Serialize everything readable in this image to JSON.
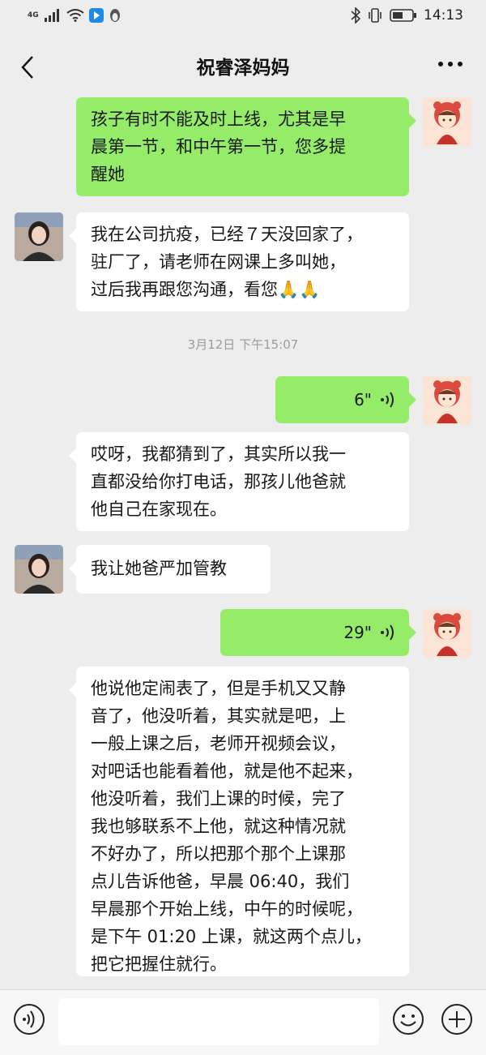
{
  "status_bar": {
    "network": "4G",
    "time": "14:13"
  },
  "header": {
    "title": "祝睿泽妈妈"
  },
  "colors": {
    "background": "#ededed",
    "incoming_bubble": "#ffffff",
    "outgoing_bubble": "#95ec69"
  },
  "messages": [
    {
      "sender": "self",
      "type": "text",
      "lines": [
        "孩子有时不能及时上线，尤其是早",
        "晨第一节，和中午第一节，您多提",
        "醒她"
      ]
    },
    {
      "sender": "contact",
      "type": "text",
      "lines": [
        "我在公司抗疫，已经７天没回家了，",
        "驻厂了，请老师在网课上多叫她，",
        "过后我再跟您沟通，看您🙏🙏"
      ]
    },
    {
      "sender": "self",
      "type": "voice",
      "duration": "6\""
    },
    {
      "sender": "contact",
      "type": "text",
      "lines": [
        "哎呀，我都猜到了，其实所以我一",
        "直都没给你打电话，那孩儿他爸就",
        "他自己在家现在。"
      ]
    },
    {
      "sender": "contact",
      "type": "text",
      "lines": [
        "我让她爸严加管教"
      ]
    },
    {
      "sender": "self",
      "type": "voice",
      "duration": "29\""
    },
    {
      "sender": "contact",
      "type": "text",
      "lines": [
        "他说他定闹表了，但是手机又又静",
        "音了，他没听着，其实就是吧，上",
        "一般上课之后，老师开视频会议，",
        "对吧话也能看着他，就是他不起来，",
        "他没听着，我们上课的时候，完了",
        "我也够联系不上他，就这种情况就",
        "不好办了，所以把那个那个上课那",
        "点儿告诉他爸，早晨 06:40，我们",
        "早晨那个开始上线，中午的时候呢，",
        "是下午 01:20 上课，就这两个点儿，",
        "把它把握住就行。"
      ]
    }
  ],
  "timestamp": "3月12日 下午15:07"
}
